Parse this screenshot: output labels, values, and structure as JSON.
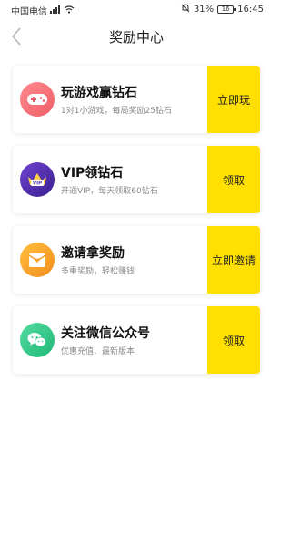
{
  "status_bar": {
    "carrier": "中国电信",
    "battery_percent": "31%",
    "battery_level": "16",
    "time": "16:45"
  },
  "nav": {
    "title": "奖励中心"
  },
  "rewards": [
    {
      "title": "玩游戏赢钻石",
      "subtitle": "1对1小游戏，每局奖励25钻石",
      "action": "立即玩",
      "icon": "gamepad-icon",
      "icon_color": "#f06a73"
    },
    {
      "title": "VIP领钻石",
      "subtitle": "开通VIP，每天领取60钻石",
      "action": "领取",
      "icon": "vip-crown-icon",
      "icon_color": "#5b36b5"
    },
    {
      "title": "邀请拿奖励",
      "subtitle": "多重奖励，轻松赚钱",
      "action": "立即邀请",
      "icon": "invite-envelope-icon",
      "icon_color": "#f5a12a"
    },
    {
      "title": "关注微信公众号",
      "subtitle": "优惠充值、最新版本",
      "action": "领取",
      "icon": "wechat-icon",
      "icon_color": "#34c98a"
    }
  ],
  "colors": {
    "action_bg": "#ffe000"
  }
}
